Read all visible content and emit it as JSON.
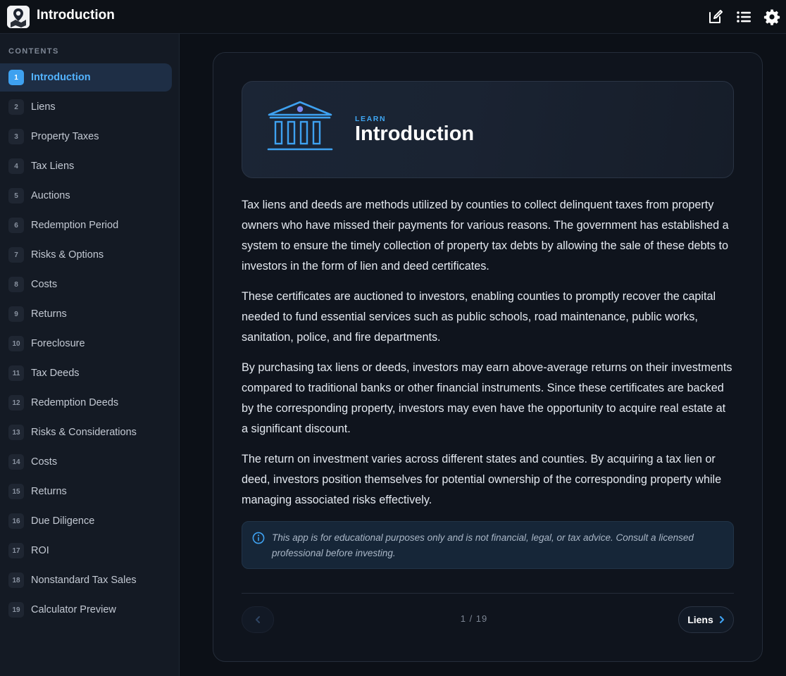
{
  "app": {
    "title": "Introduction"
  },
  "colors": {
    "accent": "#3ea1f0",
    "accent_text": "#53b3ff",
    "background": "#0c1017",
    "sidebar": "#141a24",
    "card": "#0f141d"
  },
  "topbar": {
    "icons": [
      "edit-icon",
      "list-icon",
      "settings-gear-icon"
    ]
  },
  "sidebar": {
    "heading": "CONTENTS",
    "items": [
      {
        "num": "1",
        "label": "Introduction",
        "active": true
      },
      {
        "num": "2",
        "label": "Liens"
      },
      {
        "num": "3",
        "label": "Property Taxes"
      },
      {
        "num": "4",
        "label": "Tax Liens"
      },
      {
        "num": "5",
        "label": "Auctions"
      },
      {
        "num": "6",
        "label": "Redemption Period"
      },
      {
        "num": "7",
        "label": "Risks & Options"
      },
      {
        "num": "8",
        "label": "Costs"
      },
      {
        "num": "9",
        "label": "Returns"
      },
      {
        "num": "10",
        "label": "Foreclosure"
      },
      {
        "num": "11",
        "label": "Tax Deeds"
      },
      {
        "num": "12",
        "label": "Redemption Deeds"
      },
      {
        "num": "13",
        "label": "Risks & Considerations"
      },
      {
        "num": "14",
        "label": "Costs"
      },
      {
        "num": "15",
        "label": "Returns"
      },
      {
        "num": "16",
        "label": "Due Diligence"
      },
      {
        "num": "17",
        "label": "ROI"
      },
      {
        "num": "18",
        "label": "Nonstandard Tax Sales"
      },
      {
        "num": "19",
        "label": "Calculator Preview"
      }
    ]
  },
  "hero": {
    "icon": "bank-building-icon",
    "kicker": "LEARN",
    "title": "Introduction"
  },
  "content": {
    "paragraphs": [
      "Tax liens and deeds are methods utilized by counties to collect delinquent taxes from property owners who have missed their payments for various reasons. The government has established a system to ensure the timely collection of property tax debts by allowing the sale of these debts to investors in the form of lien and deed certificates.",
      "These certificates are auctioned to investors, enabling counties to promptly recover the capital needed to fund essential services such as public schools, road maintenance, public works, sanitation, police, and fire departments.",
      "By purchasing tax liens or deeds, investors may earn above-average returns on their investments compared to traditional banks or other financial instruments. Since these certificates are backed by the corresponding property, investors may even have the opportunity to acquire real estate at a significant discount.",
      "The return on investment varies across different states and counties. By acquiring a tax lien or deed, investors position themselves for potential ownership of the corresponding property while managing associated risks effectively."
    ]
  },
  "notice": {
    "icon": "info-icon",
    "text": "This app is for educational purposes only and is not financial, legal, or tax advice. Consult a licensed professional before investing."
  },
  "pagination": {
    "current": "1",
    "separator": "/",
    "total": "19",
    "text": "1 / 19",
    "next_label": "Liens"
  }
}
